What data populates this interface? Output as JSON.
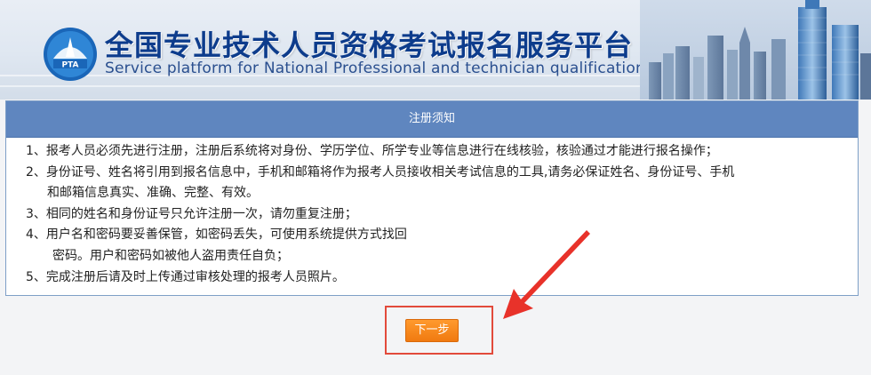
{
  "header": {
    "logo_text": "PTA",
    "title_cn": "全国专业技术人员资格考试报名服务平台",
    "title_en": "Service platform for National Professional and technician  qualification test"
  },
  "notice": {
    "heading": "注册须知",
    "lines": [
      "1、报考人员必须先进行注册，注册后系统将对身份、学历学位、所学专业等信息进行在线核验，核验通过才能进行报名操作；",
      "2、身份证号、姓名将引用到报名信息中，手机和邮箱将作为报考人员接收相关考试信息的工具,请务必保证姓名、身份证号、手机",
      "和邮箱信息真实、准确、完整、有效。",
      "3、相同的姓名和身份证号只允许注册一次，请勿重复注册；",
      "4、用户名和密码要妥善保管，如密码丢失，可使用系统提供方式找回",
      "密码。用户和密码如被他人盗用责任自负；",
      "5、完成注册后请及时上传通过审核处理的报考人员照片。"
    ]
  },
  "actions": {
    "next_label": "下一步"
  },
  "icons": {
    "logo": "pta-logo-icon",
    "arrow": "red-arrow-icon"
  },
  "colors": {
    "panel_header": "#5f86bf",
    "title_blue": "#0d3c8c",
    "button_orange": "#f07a10",
    "highlight_red": "#e24a3b"
  }
}
